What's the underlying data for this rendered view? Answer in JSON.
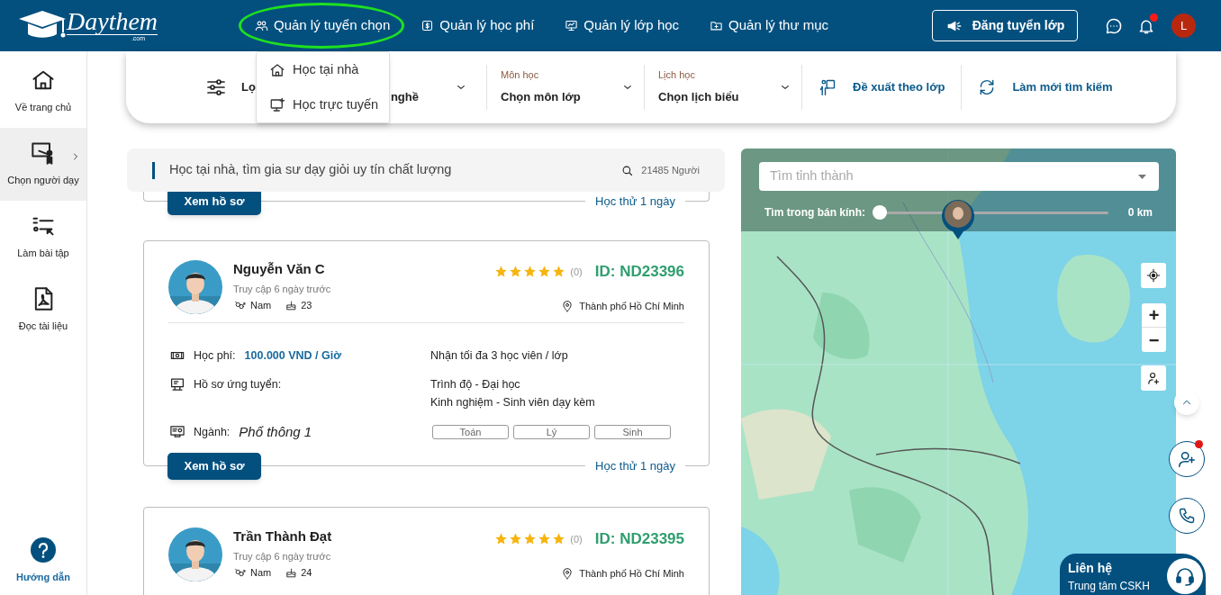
{
  "header": {
    "logo": {
      "text": "Daythem",
      "suffix": ".com"
    },
    "nav": [
      {
        "label": "Quản lý tuyển chọn",
        "kind": "users",
        "circled": true
      },
      {
        "label": "Quản lý học phí",
        "kind": "fee",
        "circled": false
      },
      {
        "label": "Quản lý lớp học",
        "kind": "board",
        "circled": false
      },
      {
        "label": "Quản lý thư mục",
        "kind": "folder",
        "circled": false
      }
    ],
    "post_button": "Đăng tuyển lớp",
    "unread_notifications": true,
    "avatar_initial": "L"
  },
  "nav_menu": [
    {
      "label": "Học tại nhà",
      "kind": "home"
    },
    {
      "label": "Học trực tuyến",
      "kind": "online"
    }
  ],
  "sidebar": {
    "items": [
      {
        "label": "Về trang chủ",
        "kind": "home",
        "selected": false
      },
      {
        "label": "Chọn người dạy",
        "kind": "teacher",
        "selected": true
      },
      {
        "label": "Làm bài tập",
        "kind": "quiz",
        "selected": false
      },
      {
        "label": "Đọc tài liệu",
        "kind": "pdf",
        "selected": false
      }
    ],
    "help": "Hướng dẫn"
  },
  "filters": {
    "first": {
      "label_fragment": "Lọ",
      "value_fragment": "nghề"
    },
    "selects": [
      {
        "label": "Môn học",
        "value": "Chọn môn lớp"
      },
      {
        "label": "Lịch học",
        "value": "Chọn lịch biểu"
      }
    ],
    "actions": [
      {
        "label": "Đề xuất theo lớp",
        "kind": "suggest"
      },
      {
        "label": "Làm mới tìm kiếm",
        "kind": "refresh"
      }
    ]
  },
  "search_bar": {
    "text": "Học tại nhà, tìm gia sư dạy giỏi uy tín chất lượng",
    "count": "21485 Người"
  },
  "cards": [
    {
      "kind": "tail",
      "button": "Xem hồ sơ",
      "trial": "Học thử 1 ngày"
    },
    {
      "kind": "full",
      "name": "Nguyễn Văn C",
      "last_seen": "Truy cập 6 ngày trước",
      "gender": "Nam",
      "age": "23",
      "stars": 5,
      "reviews": "(0)",
      "id": "ID: ND23396",
      "location": "Thành phố Hồ Chí Minh",
      "fee_label": "Học phí:",
      "fee": "100.000 VND / Giờ",
      "capacity": "Nhận tối đa 3 học viên / lớp",
      "profile_label": "Hồ sơ ứng tuyển:",
      "profile_lines": [
        "Trình độ - Đại học",
        "Kinh nghiệm - Sinh viên dạy kèm"
      ],
      "field_label": "Ngành:",
      "field": "Phổ thông 1",
      "subjects": [
        "Toán",
        "Lý",
        "Sinh"
      ],
      "button": "Xem hồ sơ",
      "trial": "Học thử 1 ngày"
    },
    {
      "kind": "head",
      "name": "Trần Thành Đạt",
      "last_seen": "Truy cập 6 ngày trước",
      "gender": "Nam",
      "age": "24",
      "stars": 5,
      "reviews": "(0)",
      "id": "ID: ND23395",
      "location": "Thành phố Hồ Chí Minh"
    }
  ],
  "map": {
    "kind": "picture",
    "search_placeholder": "Tìm tỉnh thành",
    "radius_label": "Tìm trong bán kính:",
    "radius": {
      "level": 0
    },
    "radius_value": "0 km",
    "zoom_in": "+",
    "zoom_out": "−"
  },
  "floating": {
    "add_user_unread": true,
    "contact_title": "Liên hệ",
    "contact_subtitle": "Trung tâm CSKH"
  }
}
